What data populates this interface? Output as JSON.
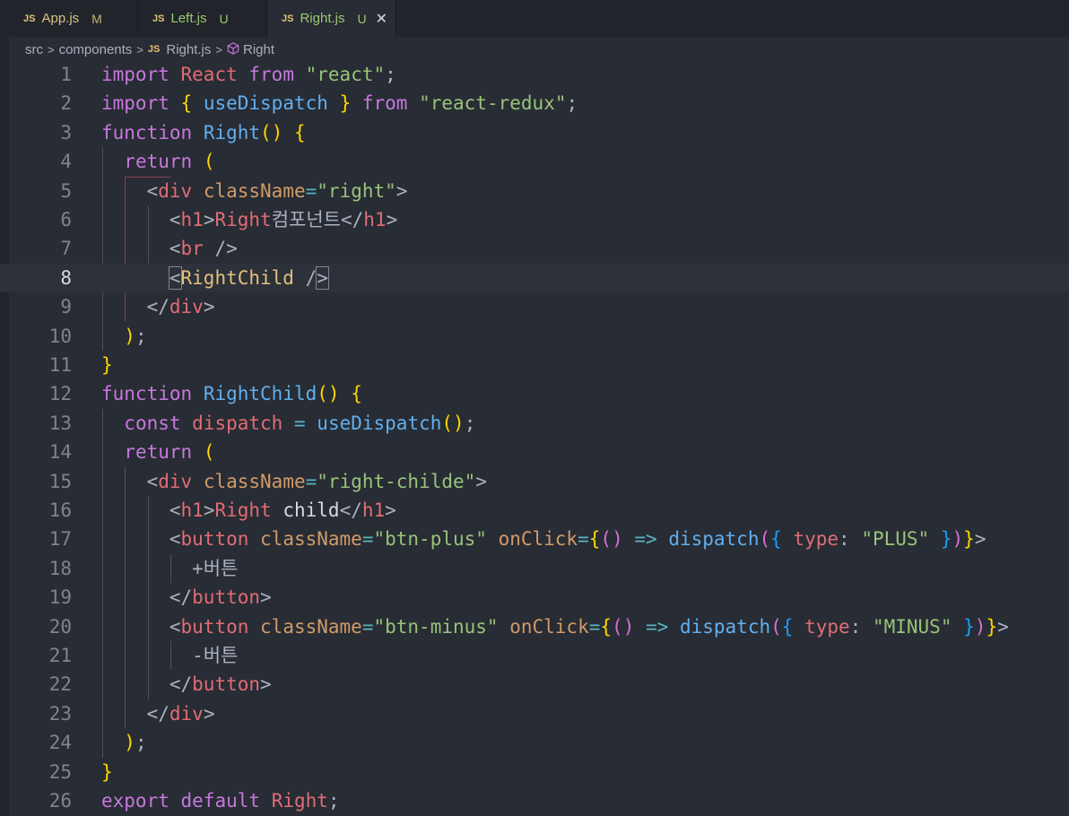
{
  "tabs": [
    {
      "icon": "JS",
      "label": "App.js",
      "status": "M"
    },
    {
      "icon": "JS",
      "label": "Left.js",
      "status": "U"
    },
    {
      "icon": "JS",
      "label": "Right.js",
      "status": "U",
      "close": "✕"
    }
  ],
  "breadcrumb": {
    "items": [
      "src",
      "components",
      "Right.js",
      "Right"
    ],
    "separator": ">",
    "file_icon": "JS",
    "symbol_icon": "symbol-class-icon"
  },
  "editor": {
    "current_line": 8,
    "line_numbers": [
      "1",
      "2",
      "3",
      "4",
      "5",
      "6",
      "7",
      "8",
      "9",
      "10",
      "11",
      "12",
      "13",
      "14",
      "15",
      "16",
      "17",
      "18",
      "19",
      "20",
      "21",
      "22",
      "23",
      "24",
      "25",
      "26"
    ],
    "lines": [
      "import React from \"react\";",
      "import { useDispatch } from \"react-redux\";",
      "function Right() {",
      "  return (",
      "    <div className=\"right\">",
      "      <h1>Right컴포넌트</h1>",
      "      <br />",
      "      <RightChild />",
      "    </div>",
      "  );",
      "}",
      "function RightChild() {",
      "  const dispatch = useDispatch();",
      "  return (",
      "    <div className=\"right-childe\">",
      "      <h1>Right child</h1>",
      "      <button className=\"btn-plus\" onClick={() => dispatch({ type: \"PLUS\" })}>",
      "        +버튼",
      "      </button>",
      "      <button className=\"btn-minus\" onClick={() => dispatch({ type: \"MINUS\" })}>",
      "        -버튼",
      "      </button>",
      "    </div>",
      "  );",
      "}",
      "export default Right;"
    ]
  },
  "colors": {
    "background": "#282c34",
    "keyword": "#c678dd",
    "tag": "#e06c75",
    "string": "#98c379",
    "function": "#61afef",
    "class": "#e5c07b",
    "attribute": "#d19a66"
  }
}
